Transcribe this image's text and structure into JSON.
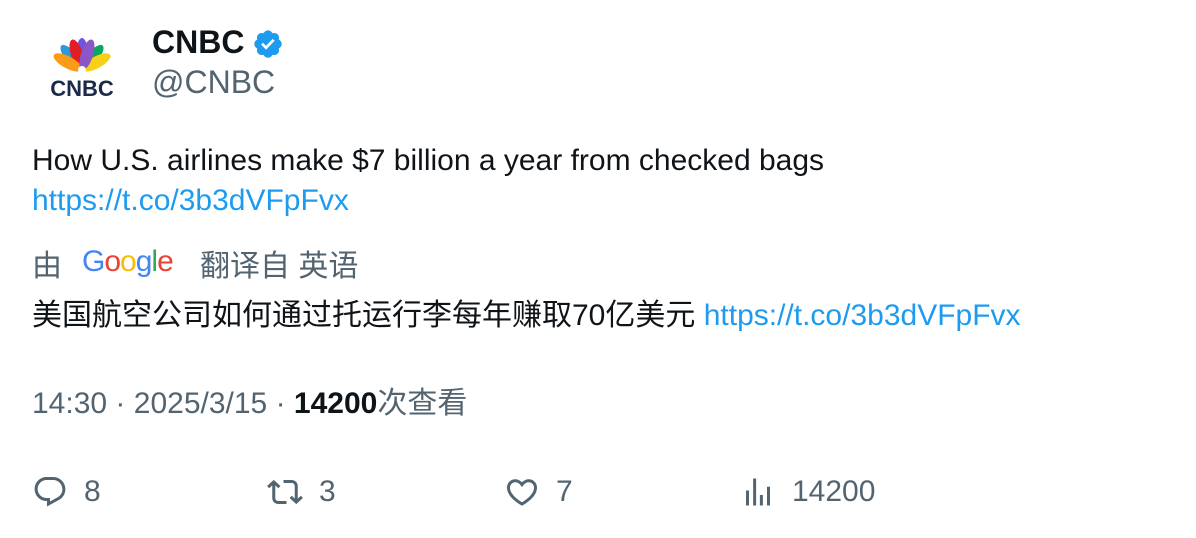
{
  "account": {
    "display_name": "CNBC",
    "handle": "@CNBC",
    "logo_text": "CNBC",
    "verified": true
  },
  "tweet": {
    "text": "How U.S. airlines make $7 billion a year from checked bags",
    "link": "https://t.co/3b3dVFpFvx"
  },
  "translation": {
    "prefix": "由",
    "provider": "Google",
    "suffix": "翻译自 英语",
    "text": "美国航空公司如何通过托运行李每年赚取70亿美元",
    "link": "https://t.co/3b3dVFpFvx"
  },
  "meta": {
    "time": "14:30",
    "separator": "·",
    "date": "2025/3/15",
    "views_count": "14200",
    "views_label": "次查看"
  },
  "actions": {
    "replies": "8",
    "retweets": "3",
    "likes": "7",
    "views": "14200"
  },
  "colors": {
    "link": "#1d9bf0",
    "secondary_text": "#536471",
    "primary_text": "#0f1419",
    "verified": "#1d9bf0"
  }
}
